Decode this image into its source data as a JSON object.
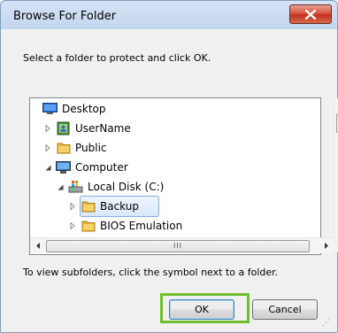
{
  "window": {
    "title": "Browse For Folder"
  },
  "instruction": "Select a folder to protect and click OK.",
  "tree": {
    "items": [
      {
        "label": "Desktop",
        "icon": "desktop-icon"
      },
      {
        "label": "UserName",
        "icon": "user-folder-icon"
      },
      {
        "label": "Public",
        "icon": "folder-icon"
      },
      {
        "label": "Computer",
        "icon": "computer-icon"
      },
      {
        "label": "Local Disk (C:)",
        "icon": "drive-icon"
      },
      {
        "label": "Backup",
        "icon": "folder-icon",
        "selected": true
      },
      {
        "label": "BIOS Emulation",
        "icon": "folder-icon"
      }
    ],
    "hscroll_grip": "III"
  },
  "hint": "To view subfolders, click the symbol next to a folder.",
  "buttons": {
    "ok": "OK",
    "cancel": "Cancel"
  },
  "colors": {
    "highlight": "#6cbf2a",
    "close": "#c0331c"
  }
}
